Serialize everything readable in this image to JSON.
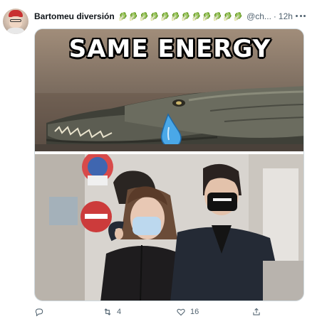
{
  "tweet": {
    "display_name": "Bartomeu diversión",
    "name_emojis": "🥬🥬🥬🥬🥬🥬🥬🥬🥬🥬🥬🥬",
    "handle": "@ch...",
    "separator": "·",
    "time": "12h",
    "media": {
      "meme_title": "SAME ENERGY"
    },
    "actions": {
      "retweet_count": "4",
      "like_count": "16"
    }
  },
  "colors": {
    "text_secondary": "#536471",
    "border": "#cfd9de"
  }
}
